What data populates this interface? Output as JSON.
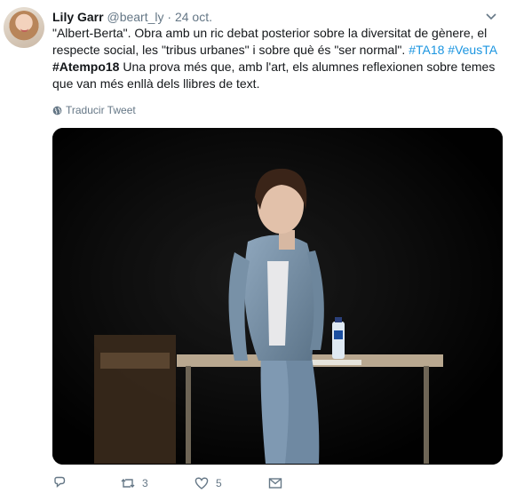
{
  "tweet": {
    "display_name": "Lily Garr",
    "handle": "@beart_ly",
    "separator": "·",
    "date": "24 oct.",
    "text": {
      "line1_a": "\"Albert-Berta\". Obra amb un ric debat posterior sobre la diversitat de gènere, el",
      "line2_a": "respecte social, les \"tribus urbanes\" i sobre què és \"ser normal\".  ",
      "tag1": "#TA18",
      "tag2": "#VeusTA",
      "tag3": "#Atempo18",
      "line3_b": " Una prova més que, amb l'art, els alumnes reflexionen sobre temes",
      "line4": "que van més enllà dels llibres de text."
    },
    "translate_label": "Traducir Tweet",
    "actions": {
      "reply_count": "",
      "retweet_count": "3",
      "like_count": "5"
    },
    "colors": {
      "link": "#1b95e0",
      "muted": "#657786"
    },
    "icons": [
      "chevron-down-icon",
      "globe-icon",
      "reply-icon",
      "retweet-icon",
      "heart-icon",
      "direct-message-icon"
    ]
  }
}
